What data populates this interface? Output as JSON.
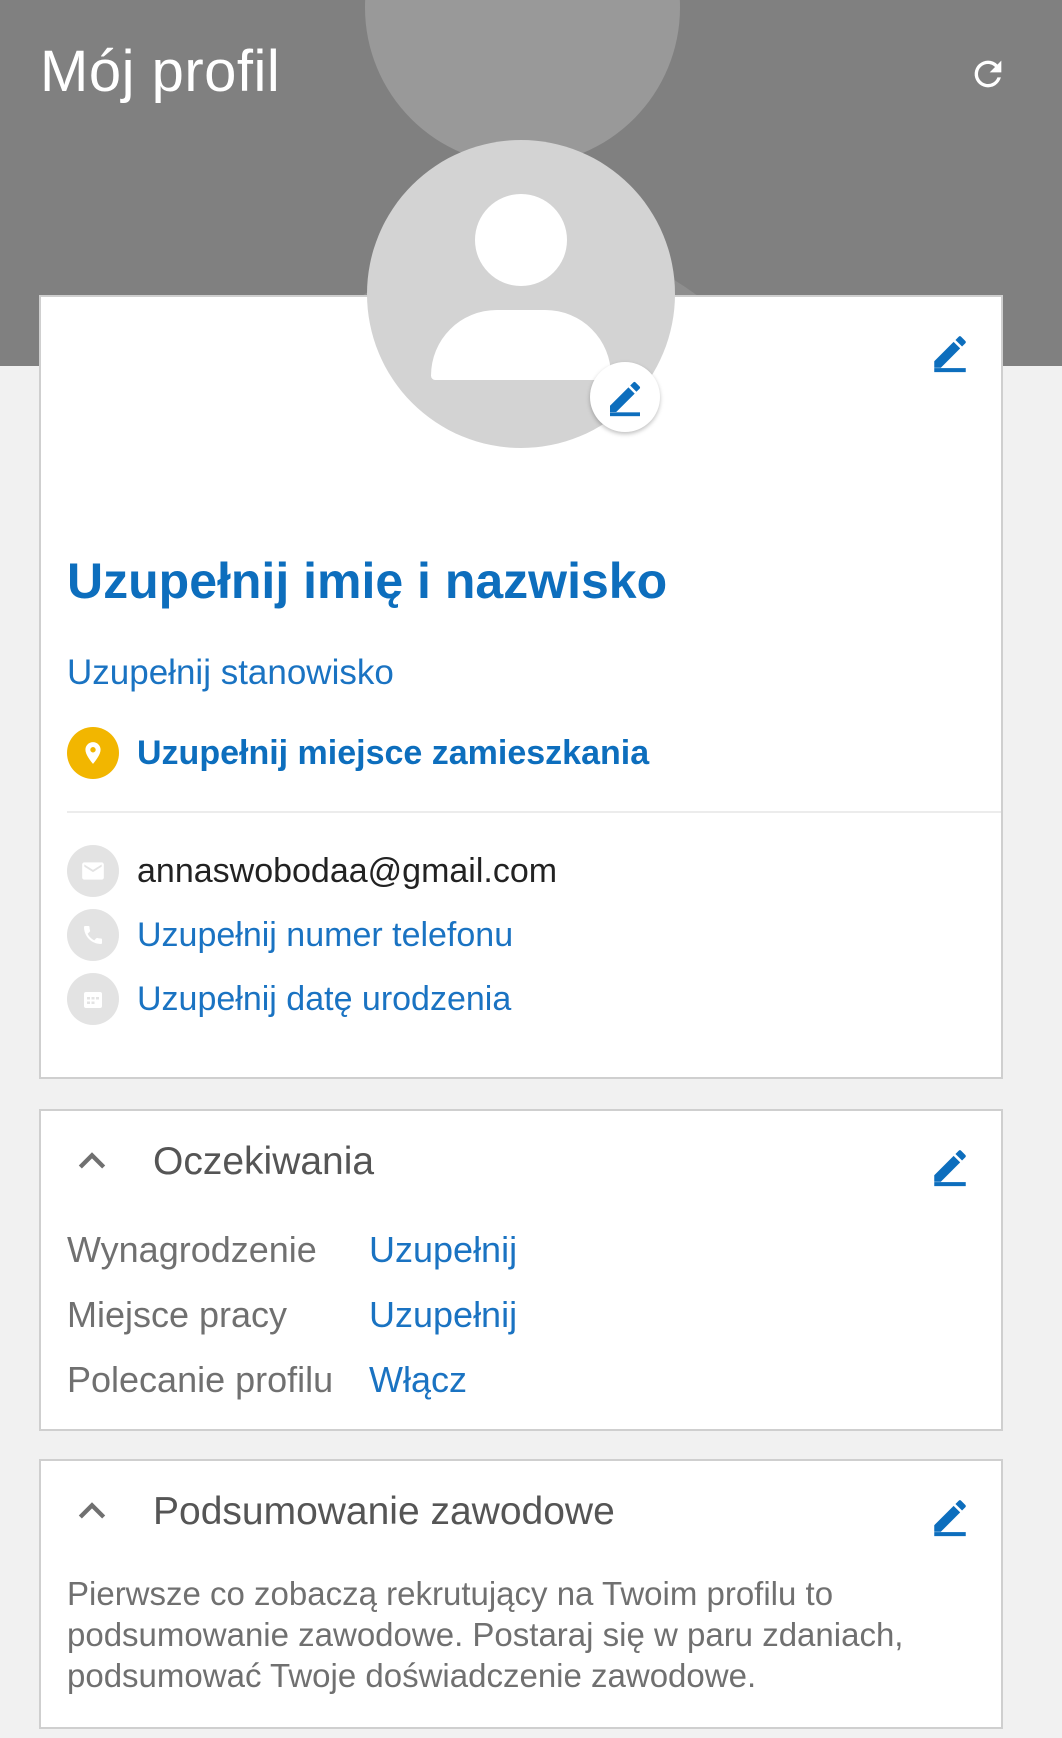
{
  "header": {
    "title": "Mój profil",
    "refresh_icon": "refresh-icon"
  },
  "profile": {
    "avatar_icon": "user-placeholder-icon",
    "name_placeholder": "Uzupełnij imię i nazwisko",
    "position_placeholder": "Uzupełnij stanowisko",
    "location_placeholder": "Uzupełnij miejsce zamieszkania",
    "email": "annaswobodaa@gmail.com",
    "phone_placeholder": "Uzupełnij numer telefonu",
    "birthdate_placeholder": "Uzupełnij datę urodzenia"
  },
  "expectations": {
    "title": "Oczekiwania",
    "rows": [
      {
        "label": "Wynagrodzenie",
        "value": "Uzupełnij"
      },
      {
        "label": "Miejsce pracy",
        "value": "Uzupełnij"
      },
      {
        "label": "Polecanie profilu",
        "value": "Włącz"
      }
    ]
  },
  "summary": {
    "title": "Podsumowanie zawodowe",
    "text": "Pierwsze co zobaczą rekrutujący na Twoim profilu to podsumowanie zawodowe. Postaraj się w paru zdaniach, podsumować Twoje doświadczenie zawodowe."
  },
  "colors": {
    "header_bg": "#808080",
    "link_blue": "#1a73c2",
    "title_blue": "#0d6ebd",
    "location_badge": "#f2b600"
  }
}
